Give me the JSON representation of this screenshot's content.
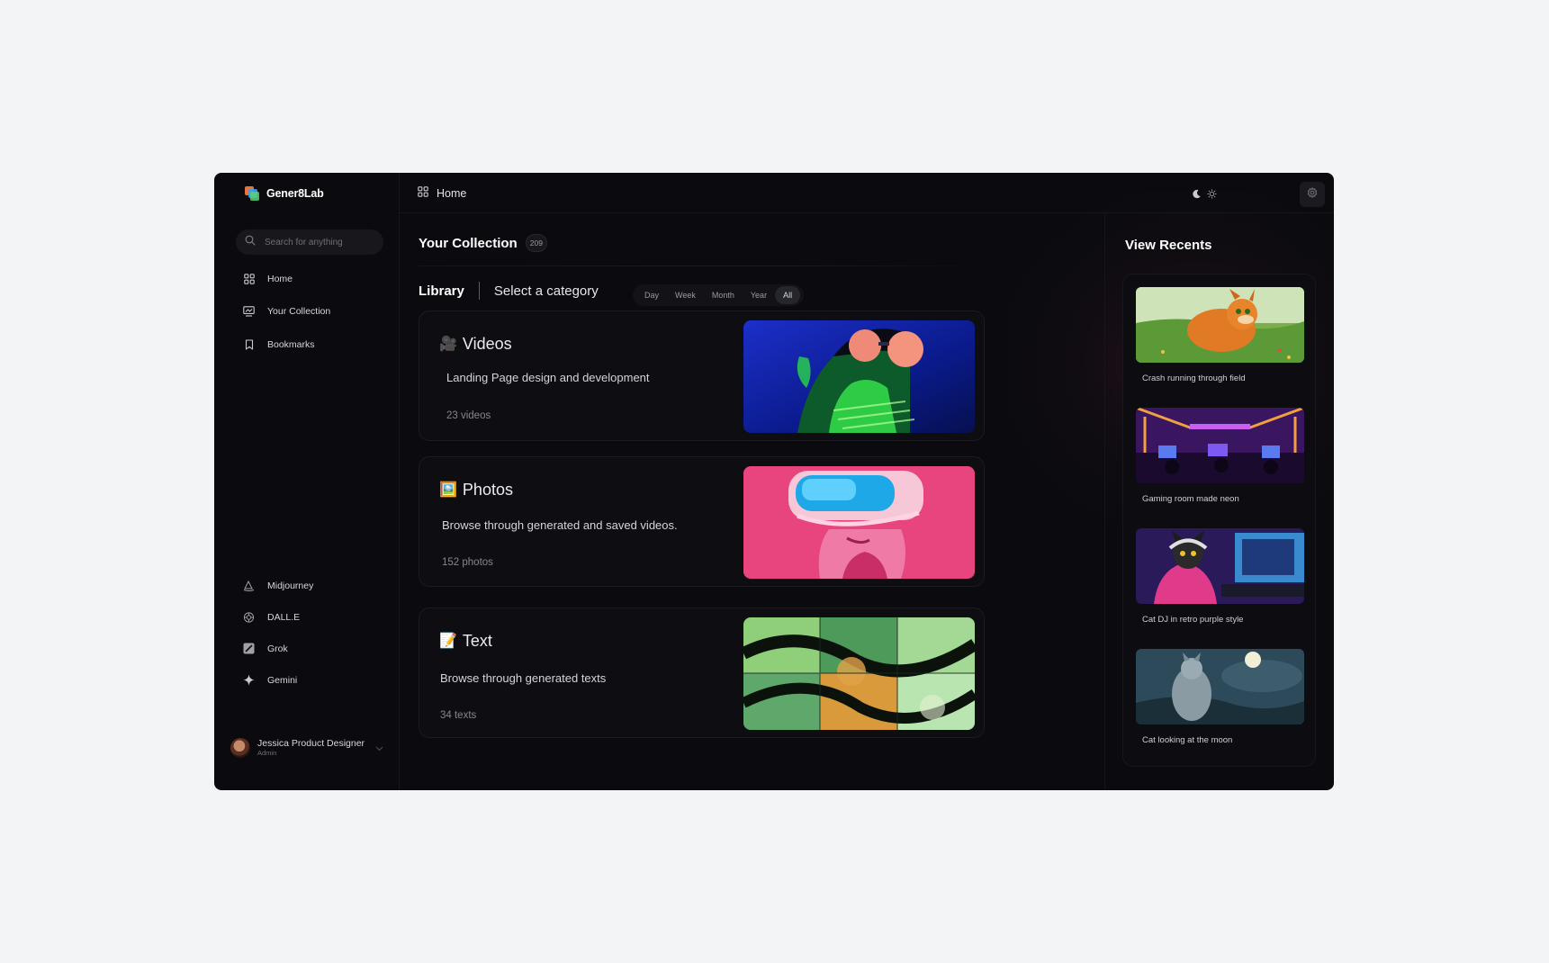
{
  "app": {
    "name": "Gener8Lab"
  },
  "sidebar": {
    "search_placeholder": "Search for anything",
    "nav": [
      {
        "label": "Home",
        "icon": "grid-icon"
      },
      {
        "label": "Your Collection",
        "icon": "collection-icon"
      },
      {
        "label": "Bookmarks",
        "icon": "bookmark-icon"
      }
    ],
    "models": [
      {
        "label": "Midjourney",
        "icon": "midjourney-icon"
      },
      {
        "label": "DALL.E",
        "icon": "openai-icon"
      },
      {
        "label": "Grok",
        "icon": "grok-icon"
      },
      {
        "label": "Gemini",
        "icon": "gemini-icon"
      }
    ],
    "profile": {
      "name": "Jessica Product Designer",
      "role": "Admin"
    }
  },
  "topbar": {
    "breadcrumb": "Home"
  },
  "main": {
    "title": "Your Collection",
    "count": "209",
    "tabs": {
      "library": "Library",
      "category": "Select a category"
    },
    "filters": [
      "Day",
      "Week",
      "Month",
      "Year",
      "All"
    ],
    "active_filter": "All",
    "cards": [
      {
        "emoji": "🎥",
        "title": "Videos",
        "description": "Landing Page design and development",
        "count": "23 videos"
      },
      {
        "emoji": "🖼️",
        "title": "Photos",
        "description": "Browse through generated and saved videos.",
        "count": "152 photos"
      },
      {
        "emoji": "📝",
        "title": "Text",
        "description": "Browse through generated texts",
        "count": "34 texts"
      }
    ]
  },
  "recents": {
    "title": "View Recents",
    "items": [
      {
        "caption": "Crash running through field"
      },
      {
        "caption": "Gaming room made neon"
      },
      {
        "caption": "Cat DJ in retro purple style"
      },
      {
        "caption": "Cat looking at the moon"
      }
    ]
  },
  "colors": {
    "app_background": "#0b0b0f",
    "page_background": "#f3f4f6",
    "text_primary": "#ffffff",
    "text_muted": "#86868f"
  }
}
